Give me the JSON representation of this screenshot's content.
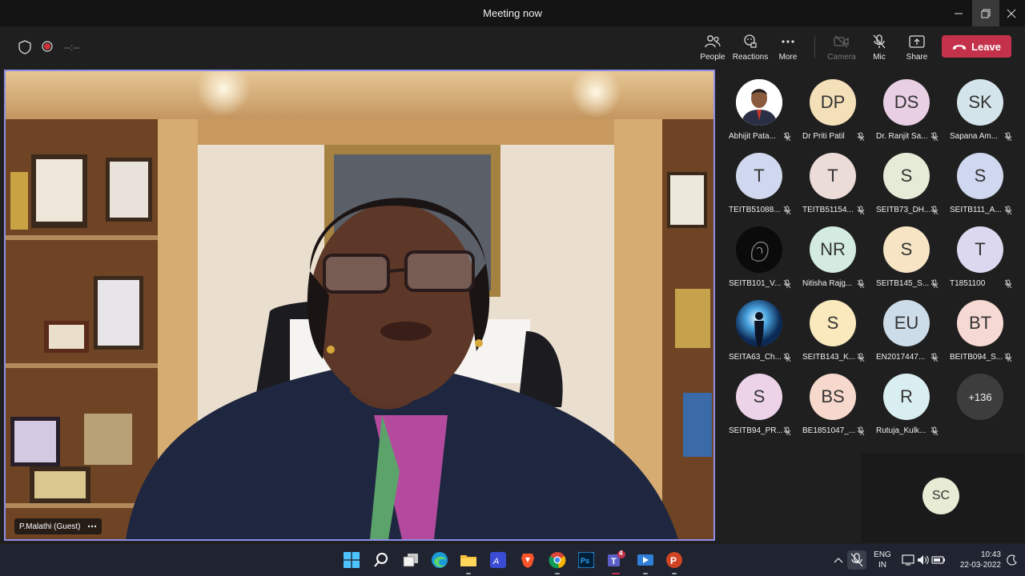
{
  "window": {
    "title": "Meeting now"
  },
  "toolbar": {
    "timer": "--:--",
    "people_label": "People",
    "reactions_label": "Reactions",
    "more_label": "More",
    "camera_label": "Camera",
    "mic_label": "Mic",
    "share_label": "Share",
    "leave_label": "Leave",
    "leave_color": "#c4314b"
  },
  "main_video": {
    "speaker_name": "P.Malathi (Guest)"
  },
  "participants": [
    {
      "name": "Abhijit Pata...",
      "initials": "",
      "color": "#ffffff",
      "photo": "person-photo"
    },
    {
      "name": "Dr Priti Patil",
      "initials": "DP",
      "color": "#f3e0b8"
    },
    {
      "name": "Dr. Ranjit Sa...",
      "initials": "DS",
      "color": "#e8cfe3"
    },
    {
      "name": "Sapana Am...",
      "initials": "SK",
      "color": "#d3e4ea"
    },
    {
      "name": "TEITB51088...",
      "initials": "T",
      "color": "#d0d8ef"
    },
    {
      "name": "TEITB51154...",
      "initials": "T",
      "color": "#ecdcd8"
    },
    {
      "name": "SEITB73_DH...",
      "initials": "S",
      "color": "#e5ebd6"
    },
    {
      "name": "SEITB111_A...",
      "initials": "S",
      "color": "#d0d8ef"
    },
    {
      "name": "SEITB101_V...",
      "initials": "",
      "color": "#111111",
      "photo": "dark-photo"
    },
    {
      "name": "Nitisha Rajg...",
      "initials": "NR",
      "color": "#d3ecdf"
    },
    {
      "name": "SEITB145_S...",
      "initials": "S",
      "color": "#f6e4c4"
    },
    {
      "name": "T1851100",
      "initials": "T",
      "color": "#dcd8ef"
    },
    {
      "name": "SEITA63_Ch...",
      "initials": "",
      "color": "#1b3d6e",
      "photo": "silhouette-photo"
    },
    {
      "name": "SEITB143_K...",
      "initials": "S",
      "color": "#f9e9bc"
    },
    {
      "name": "EN2017447...",
      "initials": "EU",
      "color": "#cddce9"
    },
    {
      "name": "BEITB094_S...",
      "initials": "BT",
      "color": "#f7d9d3"
    },
    {
      "name": "SEITB94_PR...",
      "initials": "S",
      "color": "#ecd3e8"
    },
    {
      "name": "BE1851047_...",
      "initials": "BS",
      "color": "#f7d8cc"
    },
    {
      "name": "Rutuja_Kulk...",
      "initials": "R",
      "color": "#d9eef0"
    }
  ],
  "overflow_count": "+136",
  "self_view": {
    "initials": "SC"
  },
  "tray": {
    "lang_1": "ENG",
    "lang_2": "IN",
    "time": "10:43",
    "date": "22-03-2022",
    "teams_badge": "4"
  }
}
